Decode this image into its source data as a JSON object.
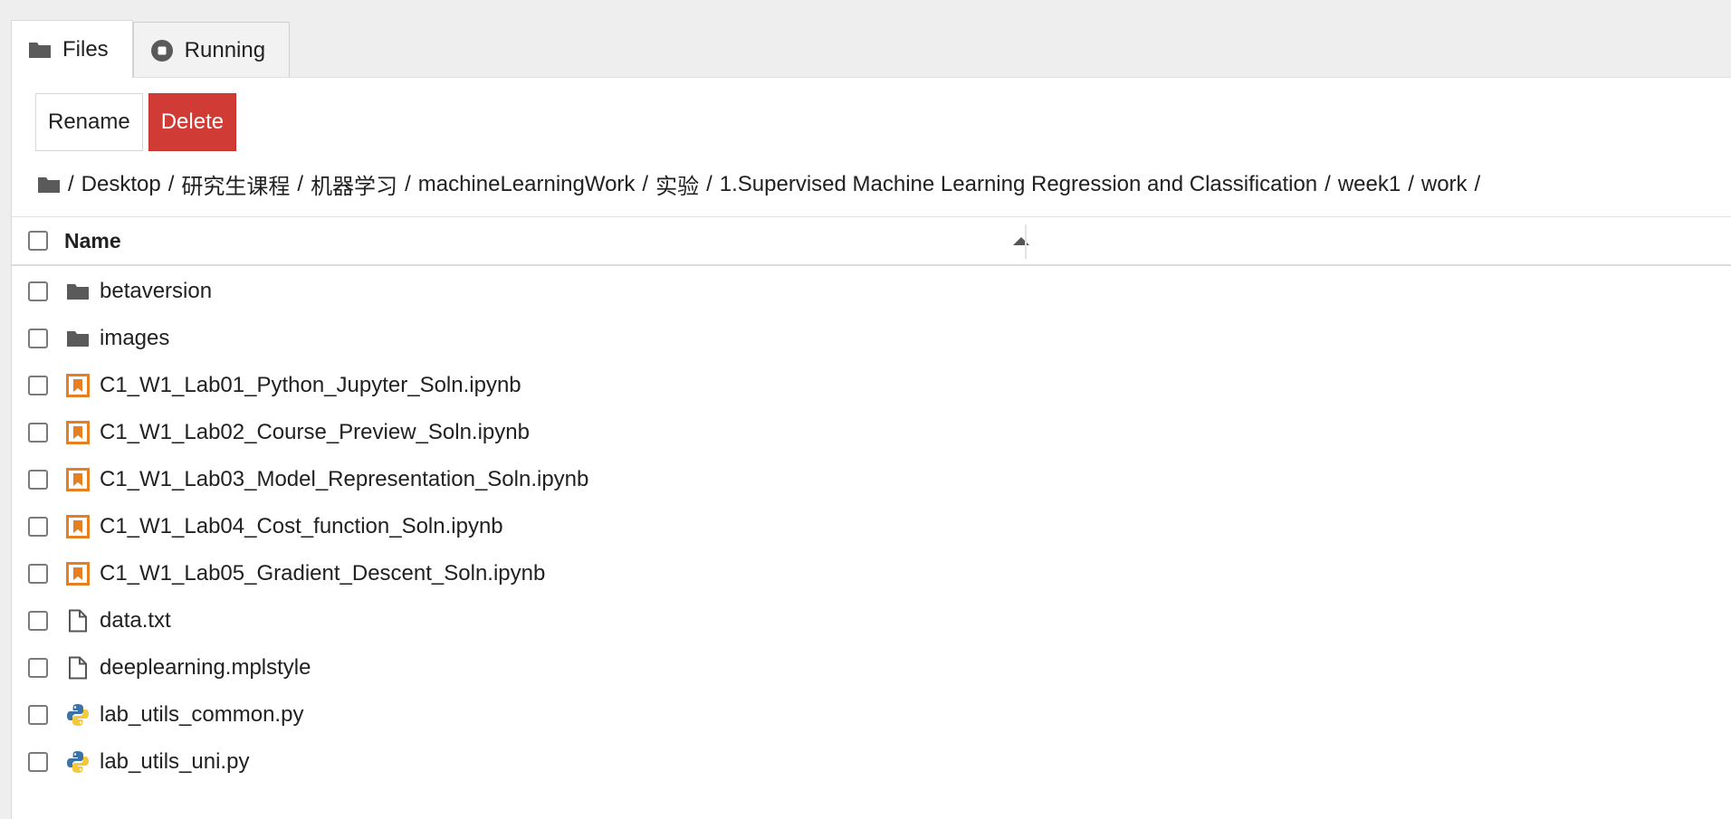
{
  "tabs": [
    {
      "label": "Files",
      "icon": "folder-icon",
      "active": true
    },
    {
      "label": "Running",
      "icon": "stop-circle-icon",
      "active": false
    }
  ],
  "toolbar": {
    "rename_label": "Rename",
    "delete_label": "Delete"
  },
  "breadcrumb": {
    "root_icon": "folder-icon",
    "items": [
      "Desktop",
      "研究生课程",
      "机器学习",
      "machineLearningWork",
      "实验",
      "1.Supervised Machine Learning Regression and Classification",
      "week1",
      "work"
    ],
    "separator": "/"
  },
  "listing": {
    "name_header": "Name",
    "sort": "ascending",
    "files": [
      {
        "name": "betaversion",
        "type": "folder",
        "icon": "folder-icon"
      },
      {
        "name": "images",
        "type": "folder",
        "icon": "folder-icon"
      },
      {
        "name": "C1_W1_Lab01_Python_Jupyter_Soln.ipynb",
        "type": "notebook",
        "icon": "notebook-icon"
      },
      {
        "name": "C1_W1_Lab02_Course_Preview_Soln.ipynb",
        "type": "notebook",
        "icon": "notebook-icon"
      },
      {
        "name": "C1_W1_Lab03_Model_Representation_Soln.ipynb",
        "type": "notebook",
        "icon": "notebook-icon"
      },
      {
        "name": "C1_W1_Lab04_Cost_function_Soln.ipynb",
        "type": "notebook",
        "icon": "notebook-icon"
      },
      {
        "name": "C1_W1_Lab05_Gradient_Descent_Soln.ipynb",
        "type": "notebook",
        "icon": "notebook-icon"
      },
      {
        "name": "data.txt",
        "type": "file",
        "icon": "file-icon"
      },
      {
        "name": "deeplearning.mplstyle",
        "type": "file",
        "icon": "file-icon"
      },
      {
        "name": "lab_utils_common.py",
        "type": "python",
        "icon": "python-icon"
      },
      {
        "name": "lab_utils_uni.py",
        "type": "python",
        "icon": "python-icon"
      }
    ]
  },
  "colors": {
    "delete_button": "#d03b35",
    "notebook_icon": "#e67e22",
    "folder_icon": "#5a5a5a"
  }
}
